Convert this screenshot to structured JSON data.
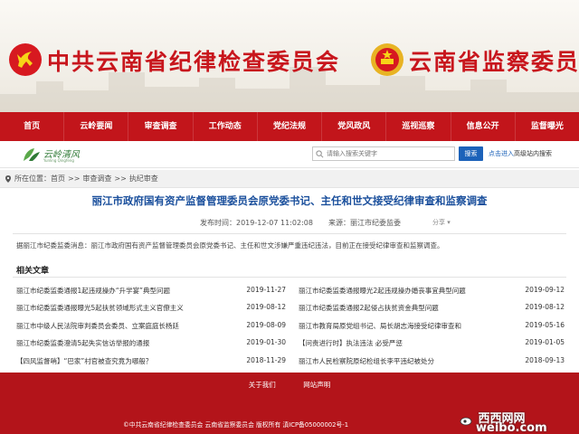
{
  "banner": {
    "title_left": "中共云南省纪律检查委员会",
    "title_right": "云南省监察委员会",
    "emblem_left": "party-emblem-icon",
    "emblem_right": "national-emblem-icon",
    "accent_color": "#c8161d"
  },
  "nav": {
    "items": [
      {
        "label": "首页"
      },
      {
        "label": "云岭要闻"
      },
      {
        "label": "审查调查"
      },
      {
        "label": "工作动态"
      },
      {
        "label": "党纪法规"
      },
      {
        "label": "党风政风"
      },
      {
        "label": "巡视巡察"
      },
      {
        "label": "信息公开"
      },
      {
        "label": "监督曝光"
      }
    ],
    "background": "#c2151b"
  },
  "logo": {
    "text": "云岭清风",
    "subtext": "Yunling Qingfeng"
  },
  "search": {
    "placeholder": "请输入搜索关键字",
    "button_label": "搜索",
    "advanced_link": "点击进入",
    "advanced_suffix": "高级站内搜索"
  },
  "breadcrumb": {
    "prefix": "所在位置：",
    "items": [
      "首页",
      "审查调查",
      "执纪审查"
    ],
    "separator": ">>"
  },
  "article": {
    "title": "丽江市政府国有资产监督管理委员会原党委书记、主任和世文接受纪律审查和监察调查",
    "published": "发布时间：2019-12-07 11:02:08",
    "source": "来源：丽江市纪委监委",
    "share": "分享 ▾",
    "summary": "据丽江市纪委监委消息：丽江市政府国有资产监督管理委员会原党委书记、主任和世文涉嫌严重违纪违法，目前正在接受纪律审查和监察调查。"
  },
  "related": {
    "title": "相关文章",
    "left": [
      {
        "title": "丽江市纪委监委通报1起违规操办“升学宴”典型问题",
        "date": "2019-11-27"
      },
      {
        "title": "丽江市纪委监委通报曝光5起扶贫领域形式主义官僚主义",
        "date": "2019-08-12"
      },
      {
        "title": "丽江市中级人民法院审判委员会委员、立案庭庭长杨廷",
        "date": "2019-08-09"
      },
      {
        "title": "丽江市纪委监委澄清5起失实信访举报的通报",
        "date": "2019-01-30"
      },
      {
        "title": "【四风监督哨】“巴家”村官被查究竟为哪般？",
        "date": "2018-11-29"
      }
    ],
    "right": [
      {
        "title": "丽江市纪委监委通报曝光2起违规操办婚丧事宜典型问题",
        "date": "2019-09-12"
      },
      {
        "title": "丽江市纪委监委通报2起侵占扶贫资金典型问题",
        "date": "2019-08-12"
      },
      {
        "title": "丽江市教育局原党组书记、局长胡志海接受纪律审查和",
        "date": "2019-05-16"
      },
      {
        "title": "【问责进行时】执法违法 必受严惩",
        "date": "2019-01-05"
      },
      {
        "title": "丽江市人民检察院原纪检组长李平违纪被处分",
        "date": "2018-09-13"
      }
    ]
  },
  "footer": {
    "links": [
      "关于我们",
      "网站声明"
    ],
    "copyright": "©中共云南省纪律检查委员会 云南省监察委员会 版权所有 滇ICP备05000002号-1",
    "background": "#b3141a"
  },
  "watermark": {
    "text_top": "西西网网",
    "text_main": "weibo.com"
  }
}
